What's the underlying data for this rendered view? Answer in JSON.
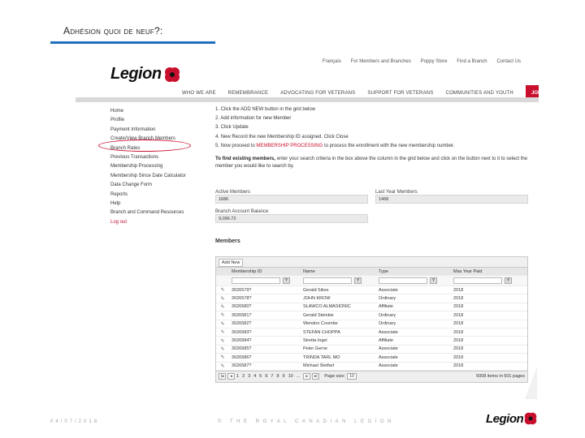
{
  "slide": {
    "title": "Adhésion quoi de neuf?:",
    "footer_date": "04/07/2018",
    "footer_center": "© THE ROYAL CANADIAN LEGION",
    "footer_logo": "Legion"
  },
  "site": {
    "logo": "Legion",
    "top_links": [
      "Français",
      "For Members and Branches",
      "Poppy Store",
      "Find a Branch",
      "Contact Us"
    ],
    "main_nav": [
      "WHO WE ARE",
      "REMEMBRANCE",
      "ADVOCATING FOR VETERANS",
      "SUPPORT FOR VETERANS",
      "COMMUNITIES AND YOUTH"
    ],
    "join_label": "JOIN US",
    "accent": "#c8102e"
  },
  "left_menu": [
    "Home",
    "Profile",
    "Payment Information",
    "Create/View Branch Members",
    "Branch Rates",
    "Previous Transactions",
    "Membership Processing",
    "Membership Since Date Calculator",
    "Data Change Form",
    "Reports",
    "Help",
    "Branch and Command Resources",
    "Log out"
  ],
  "steps": [
    "1. Click the ADD NEW button in the grid below",
    "2. Add information for new Member",
    "3. Click Update",
    "4. New Record the new Membership ID assigned. Click Close",
    "5. Now proceed to "
  ],
  "step5_link": "MEMBERSHIP PROCESSING",
  "step5_tail": " to process the enrollment with the new membership number.",
  "find_bold": "To find existing members,",
  "find_text": " enter your search criteria in the box above the column in the grid below and click on the button next to it to select the member you would like to search by.",
  "fields": {
    "active_label": "Active Members",
    "active_value": "1686",
    "lastyear_label": "Last Year Members",
    "lastyear_value": "1468",
    "balance_label": "Branch Account Balance",
    "balance_value": "9,096.72"
  },
  "members_heading": "Members",
  "grid": {
    "add_new": "Add New",
    "columns": [
      "Membership ID",
      "Name",
      "Type",
      "Max Year Paid"
    ],
    "rows": [
      [
        "3026579?",
        "Gerald Sikes",
        "Associate",
        "2018"
      ],
      [
        "3026578?",
        "JOHN KROW",
        "Ordinary",
        "2018"
      ],
      [
        "3026580?",
        "SLAWCO ALMASIONIC",
        "Affiliate",
        "2018"
      ],
      [
        "3026581?",
        "Gerald Steinkie",
        "Ordinary",
        "2018"
      ],
      [
        "3026582?",
        "Wendon Coombe",
        "Ordinary",
        "2018"
      ],
      [
        "3026583?",
        "STEFAN CHOPPA",
        "Associate",
        "2018"
      ],
      [
        "3026584?",
        "Stretta Ingel",
        "Affiliate",
        "2018"
      ],
      [
        "3026585?",
        "Peter Gerne",
        "Associate",
        "2018"
      ],
      [
        "3026586?",
        "TRINDA TARL MO",
        "Associate",
        "2018"
      ],
      [
        "3026587?",
        "Michael Stetfart",
        "Associate",
        "2018"
      ]
    ],
    "pages": [
      "1",
      "2",
      "3",
      "4",
      "5",
      "6",
      "7",
      "8",
      "9",
      "10",
      "..."
    ],
    "page_size_label": "Page size:",
    "page_size_value": "10",
    "total": "5008 items in 501 pages"
  }
}
